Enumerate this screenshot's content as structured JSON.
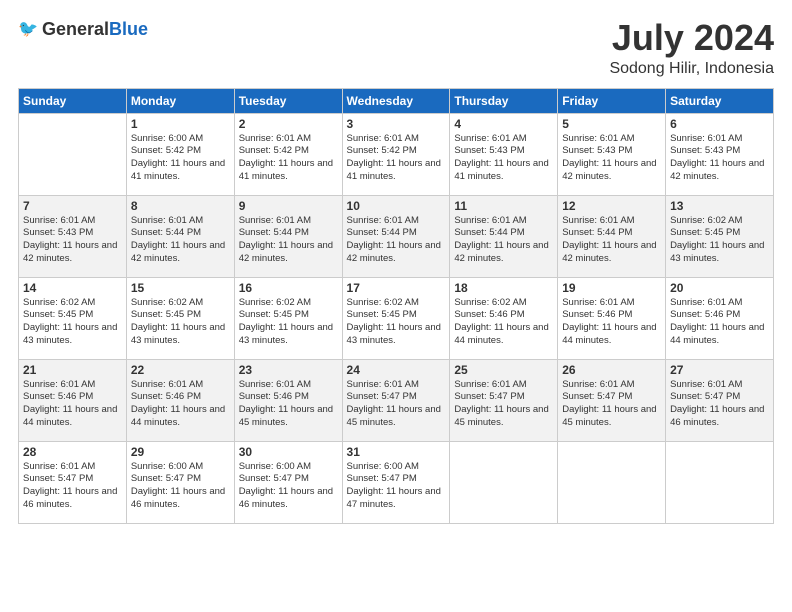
{
  "header": {
    "logo_general": "General",
    "logo_blue": "Blue",
    "month_title": "July 2024",
    "location": "Sodong Hilir, Indonesia"
  },
  "days_of_week": [
    "Sunday",
    "Monday",
    "Tuesday",
    "Wednesday",
    "Thursday",
    "Friday",
    "Saturday"
  ],
  "weeks": [
    [
      {
        "day": "",
        "sunrise": "",
        "sunset": "",
        "daylight": ""
      },
      {
        "day": "1",
        "sunrise": "Sunrise: 6:00 AM",
        "sunset": "Sunset: 5:42 PM",
        "daylight": "Daylight: 11 hours and 41 minutes."
      },
      {
        "day": "2",
        "sunrise": "Sunrise: 6:01 AM",
        "sunset": "Sunset: 5:42 PM",
        "daylight": "Daylight: 11 hours and 41 minutes."
      },
      {
        "day": "3",
        "sunrise": "Sunrise: 6:01 AM",
        "sunset": "Sunset: 5:42 PM",
        "daylight": "Daylight: 11 hours and 41 minutes."
      },
      {
        "day": "4",
        "sunrise": "Sunrise: 6:01 AM",
        "sunset": "Sunset: 5:43 PM",
        "daylight": "Daylight: 11 hours and 41 minutes."
      },
      {
        "day": "5",
        "sunrise": "Sunrise: 6:01 AM",
        "sunset": "Sunset: 5:43 PM",
        "daylight": "Daylight: 11 hours and 42 minutes."
      },
      {
        "day": "6",
        "sunrise": "Sunrise: 6:01 AM",
        "sunset": "Sunset: 5:43 PM",
        "daylight": "Daylight: 11 hours and 42 minutes."
      }
    ],
    [
      {
        "day": "7",
        "sunrise": "Sunrise: 6:01 AM",
        "sunset": "Sunset: 5:43 PM",
        "daylight": "Daylight: 11 hours and 42 minutes."
      },
      {
        "day": "8",
        "sunrise": "Sunrise: 6:01 AM",
        "sunset": "Sunset: 5:44 PM",
        "daylight": "Daylight: 11 hours and 42 minutes."
      },
      {
        "day": "9",
        "sunrise": "Sunrise: 6:01 AM",
        "sunset": "Sunset: 5:44 PM",
        "daylight": "Daylight: 11 hours and 42 minutes."
      },
      {
        "day": "10",
        "sunrise": "Sunrise: 6:01 AM",
        "sunset": "Sunset: 5:44 PM",
        "daylight": "Daylight: 11 hours and 42 minutes."
      },
      {
        "day": "11",
        "sunrise": "Sunrise: 6:01 AM",
        "sunset": "Sunset: 5:44 PM",
        "daylight": "Daylight: 11 hours and 42 minutes."
      },
      {
        "day": "12",
        "sunrise": "Sunrise: 6:01 AM",
        "sunset": "Sunset: 5:44 PM",
        "daylight": "Daylight: 11 hours and 42 minutes."
      },
      {
        "day": "13",
        "sunrise": "Sunrise: 6:02 AM",
        "sunset": "Sunset: 5:45 PM",
        "daylight": "Daylight: 11 hours and 43 minutes."
      }
    ],
    [
      {
        "day": "14",
        "sunrise": "Sunrise: 6:02 AM",
        "sunset": "Sunset: 5:45 PM",
        "daylight": "Daylight: 11 hours and 43 minutes."
      },
      {
        "day": "15",
        "sunrise": "Sunrise: 6:02 AM",
        "sunset": "Sunset: 5:45 PM",
        "daylight": "Daylight: 11 hours and 43 minutes."
      },
      {
        "day": "16",
        "sunrise": "Sunrise: 6:02 AM",
        "sunset": "Sunset: 5:45 PM",
        "daylight": "Daylight: 11 hours and 43 minutes."
      },
      {
        "day": "17",
        "sunrise": "Sunrise: 6:02 AM",
        "sunset": "Sunset: 5:45 PM",
        "daylight": "Daylight: 11 hours and 43 minutes."
      },
      {
        "day": "18",
        "sunrise": "Sunrise: 6:02 AM",
        "sunset": "Sunset: 5:46 PM",
        "daylight": "Daylight: 11 hours and 44 minutes."
      },
      {
        "day": "19",
        "sunrise": "Sunrise: 6:01 AM",
        "sunset": "Sunset: 5:46 PM",
        "daylight": "Daylight: 11 hours and 44 minutes."
      },
      {
        "day": "20",
        "sunrise": "Sunrise: 6:01 AM",
        "sunset": "Sunset: 5:46 PM",
        "daylight": "Daylight: 11 hours and 44 minutes."
      }
    ],
    [
      {
        "day": "21",
        "sunrise": "Sunrise: 6:01 AM",
        "sunset": "Sunset: 5:46 PM",
        "daylight": "Daylight: 11 hours and 44 minutes."
      },
      {
        "day": "22",
        "sunrise": "Sunrise: 6:01 AM",
        "sunset": "Sunset: 5:46 PM",
        "daylight": "Daylight: 11 hours and 44 minutes."
      },
      {
        "day": "23",
        "sunrise": "Sunrise: 6:01 AM",
        "sunset": "Sunset: 5:46 PM",
        "daylight": "Daylight: 11 hours and 45 minutes."
      },
      {
        "day": "24",
        "sunrise": "Sunrise: 6:01 AM",
        "sunset": "Sunset: 5:47 PM",
        "daylight": "Daylight: 11 hours and 45 minutes."
      },
      {
        "day": "25",
        "sunrise": "Sunrise: 6:01 AM",
        "sunset": "Sunset: 5:47 PM",
        "daylight": "Daylight: 11 hours and 45 minutes."
      },
      {
        "day": "26",
        "sunrise": "Sunrise: 6:01 AM",
        "sunset": "Sunset: 5:47 PM",
        "daylight": "Daylight: 11 hours and 45 minutes."
      },
      {
        "day": "27",
        "sunrise": "Sunrise: 6:01 AM",
        "sunset": "Sunset: 5:47 PM",
        "daylight": "Daylight: 11 hours and 46 minutes."
      }
    ],
    [
      {
        "day": "28",
        "sunrise": "Sunrise: 6:01 AM",
        "sunset": "Sunset: 5:47 PM",
        "daylight": "Daylight: 11 hours and 46 minutes."
      },
      {
        "day": "29",
        "sunrise": "Sunrise: 6:00 AM",
        "sunset": "Sunset: 5:47 PM",
        "daylight": "Daylight: 11 hours and 46 minutes."
      },
      {
        "day": "30",
        "sunrise": "Sunrise: 6:00 AM",
        "sunset": "Sunset: 5:47 PM",
        "daylight": "Daylight: 11 hours and 46 minutes."
      },
      {
        "day": "31",
        "sunrise": "Sunrise: 6:00 AM",
        "sunset": "Sunset: 5:47 PM",
        "daylight": "Daylight: 11 hours and 47 minutes."
      },
      {
        "day": "",
        "sunrise": "",
        "sunset": "",
        "daylight": ""
      },
      {
        "day": "",
        "sunrise": "",
        "sunset": "",
        "daylight": ""
      },
      {
        "day": "",
        "sunrise": "",
        "sunset": "",
        "daylight": ""
      }
    ]
  ]
}
